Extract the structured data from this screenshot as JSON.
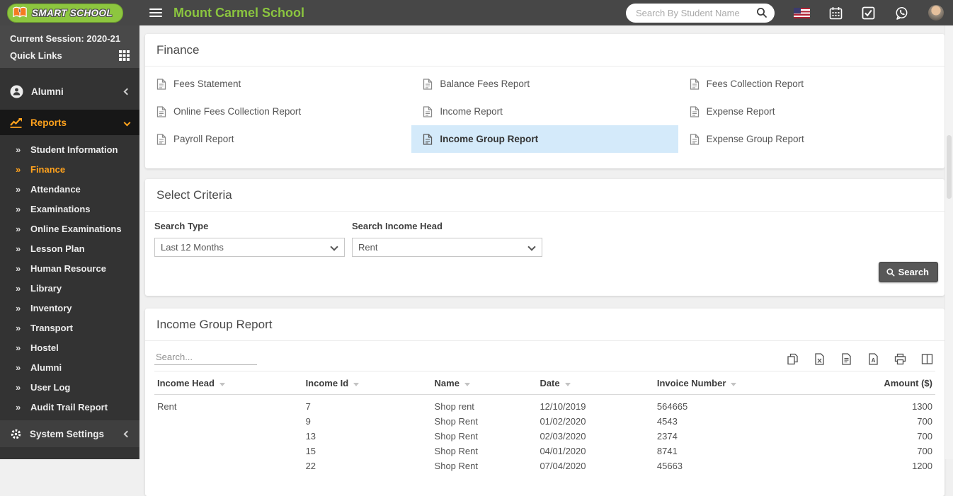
{
  "colors": {
    "header_bg": "#474747",
    "sidebar_bg": "#333333",
    "accent_orange": "#ffa21d",
    "brand_green": "#8bc53f",
    "active_link_bg": "#d4eafa"
  },
  "topbar": {
    "brand": "SMART SCHOOL",
    "title": "Mount Carmel School",
    "search_placeholder": "Search By Student Name"
  },
  "sidebar": {
    "session": "Current Session: 2020-21",
    "quick_links": "Quick Links",
    "alumni": "Alumni",
    "reports": "Reports",
    "system_settings": "System Settings",
    "submenu": [
      "Student Information",
      "Finance",
      "Attendance",
      "Examinations",
      "Online Examinations",
      "Lesson Plan",
      "Human Resource",
      "Library",
      "Inventory",
      "Transport",
      "Hostel",
      "Alumni",
      "User Log",
      "Audit Trail Report"
    ]
  },
  "finance": {
    "title": "Finance",
    "links": [
      {
        "label": "Fees Statement"
      },
      {
        "label": "Balance Fees Report"
      },
      {
        "label": "Fees Collection Report"
      },
      {
        "label": "Online Fees Collection Report"
      },
      {
        "label": "Income Report"
      },
      {
        "label": "Expense Report"
      },
      {
        "label": "Payroll Report"
      },
      {
        "label": "Income Group Report",
        "active": true
      },
      {
        "label": "Expense Group Report"
      }
    ]
  },
  "criteria": {
    "title": "Select Criteria",
    "search_type_label": "Search Type",
    "search_type_value": "Last 12 Months",
    "income_head_label": "Search Income Head",
    "income_head_value": "Rent",
    "search_button": "Search"
  },
  "report": {
    "title": "Income Group Report",
    "search_placeholder": "Search...",
    "columns": [
      "Income Head",
      "Income Id",
      "Name",
      "Date",
      "Invoice Number",
      "Amount ($)"
    ],
    "rows": [
      [
        "Rent",
        "7",
        "Shop rent",
        "12/10/2019",
        "564665",
        "1300"
      ],
      [
        "",
        "9",
        "Shop Rent",
        "01/02/2020",
        "4543",
        "700"
      ],
      [
        "",
        "13",
        "Shop Rent",
        "02/03/2020",
        "2374",
        "700"
      ],
      [
        "",
        "15",
        "Shop Rent",
        "04/01/2020",
        "8741",
        "700"
      ],
      [
        "",
        "22",
        "Shop Rent",
        "07/04/2020",
        "45663",
        "1200"
      ]
    ]
  }
}
